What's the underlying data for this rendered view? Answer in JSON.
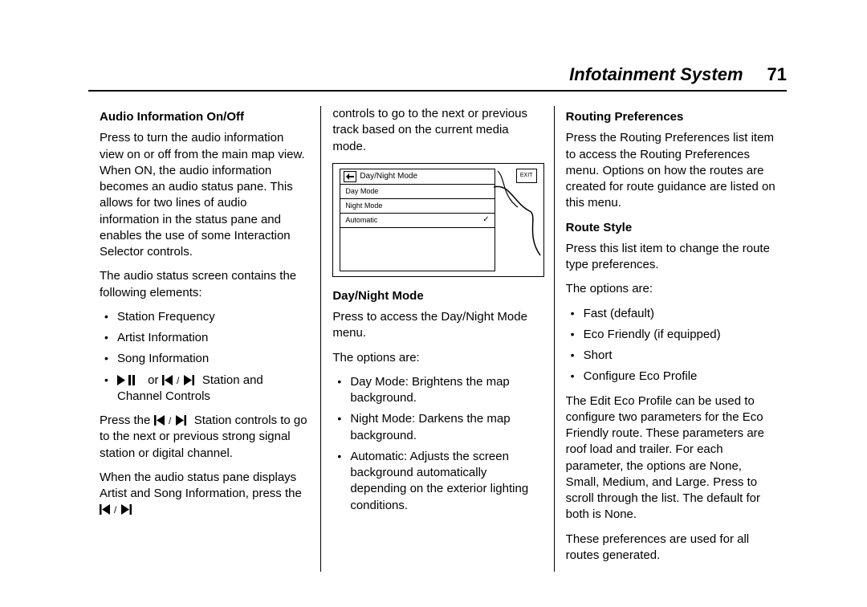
{
  "header": {
    "title": "Infotainment System",
    "page_number": "71"
  },
  "col1": {
    "h1": "Audio Information On/Off",
    "p1": "Press to turn the audio information view on or off from the main map view. When ON, the audio information becomes an audio status pane. This allows for two lines of audio information in the status pane and enables the use of some Interaction Selector controls.",
    "p2": "The audio status screen contains the following elements:",
    "b1": "Station Frequency",
    "b2": "Artist Information",
    "b3": "Song Information",
    "b4_tail": " Station and Channel Controls",
    "b4_or": " or ",
    "p3_a": "Press the ",
    "p3_b": " Station controls to go to the next or previous strong signal station or digital channel.",
    "p4_a": "When the audio status pane displays Artist and Song Information, press the ",
    "p4_b": ""
  },
  "col2": {
    "p_cont": "controls to go to the next or previous track based on the current media mode.",
    "mini": {
      "title": "Day/Night Mode",
      "row1": "Day Mode",
      "row2": "Night Mode",
      "row3": "Automatic",
      "exit": "EXIT"
    },
    "h1": "Day/Night Mode",
    "p1": "Press to access the Day/Night Mode menu.",
    "p2": "The options are:",
    "b1": "Day Mode: Brightens the map background.",
    "b2": "Night Mode: Darkens the map background.",
    "b3": "Automatic: Adjusts the screen background automatically depending on the exterior lighting conditions."
  },
  "col3": {
    "h1": "Routing Preferences",
    "p1": "Press the Routing Preferences list item to access the Routing Preferences menu. Options on how the routes are created for route guidance are listed on this menu.",
    "h2": "Route Style",
    "p2": "Press this list item to change the route type preferences.",
    "p3": "The options are:",
    "b1": "Fast (default)",
    "b2": "Eco Friendly (if equipped)",
    "b3": "Short",
    "b4": "Configure Eco Profile",
    "p4": "The Edit Eco Profile can be used to configure two parameters for the Eco Friendly route. These parameters are roof load and trailer. For each parameter, the options are None, Small, Medium, and Large. Press to scroll through the list. The default for both is None.",
    "p5": "These preferences are used for all routes generated."
  },
  "icons": {
    "play_pause": "play-pause-icon",
    "prev_next": "prev-next-track-icon"
  }
}
